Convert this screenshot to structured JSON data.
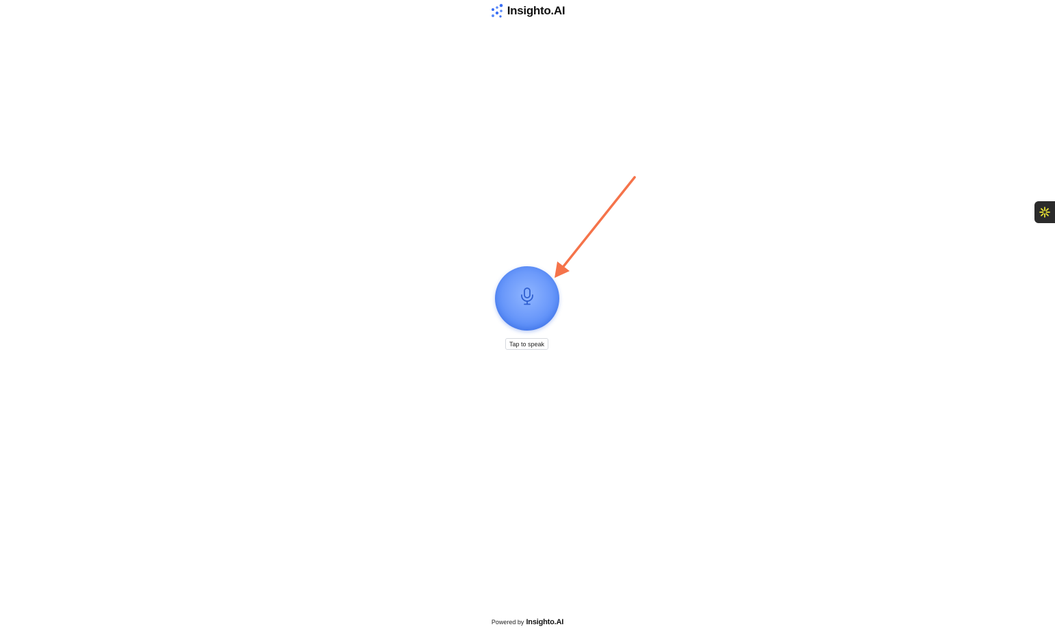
{
  "header": {
    "brand_name": "Insighto.AI",
    "logo_icon": "dots-logo-icon"
  },
  "voice": {
    "mic_icon": "microphone-icon",
    "tap_label": "Tap to speak",
    "accent_color": "#5a8df7"
  },
  "annotation": {
    "arrow_color": "#f5734a"
  },
  "side_widget": {
    "icon": "sparkle-icon",
    "icon_color": "#e8e233"
  },
  "footer": {
    "powered_by": "Powered by",
    "brand_name": "Insighto.AI"
  }
}
